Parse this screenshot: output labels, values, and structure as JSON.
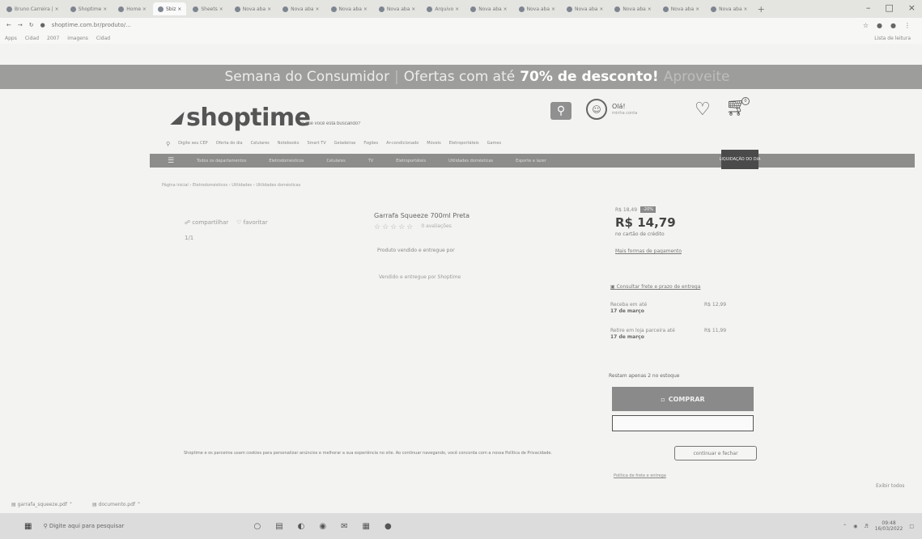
{
  "browser": {
    "tabs": [
      {
        "label": "Bruno Carreira | ×",
        "active": false
      },
      {
        "label": "Shoptime ×",
        "active": false
      },
      {
        "label": "Home ×",
        "active": false
      },
      {
        "label": "Sbiz ×",
        "active": true
      },
      {
        "label": "Sheets ×",
        "active": false
      },
      {
        "label": "Nova aba ×",
        "active": false
      },
      {
        "label": "Nova aba ×",
        "active": false
      },
      {
        "label": "Nova aba ×",
        "active": false
      },
      {
        "label": "Nova aba ×",
        "active": false
      },
      {
        "label": "Arquivo ×",
        "active": false
      },
      {
        "label": "Nova aba ×",
        "active": false
      },
      {
        "label": "Nova aba ×",
        "active": false
      },
      {
        "label": "Nova aba ×",
        "active": false
      },
      {
        "label": "Nova aba ×",
        "active": false
      },
      {
        "label": "Nova aba ×",
        "active": false
      },
      {
        "label": "Nova aba ×",
        "active": false
      }
    ],
    "url": "shoptime.com.br/produto/...",
    "bookmarks": [
      "Apps",
      "Cidad",
      "2007",
      "imagens",
      "Cidad"
    ],
    "reading_list": "Lista de leitura"
  },
  "promo": {
    "lead": "Semana do Consumidor",
    "text": "Ofertas com até",
    "highlight": "70% de desconto!",
    "tail": "Aproveite"
  },
  "header": {
    "logo": "shoptime",
    "search_placeholder": "o que você está buscando?",
    "greeting": "Olá!",
    "greeting_sub": "minha conta",
    "cart_count": "0"
  },
  "cep_bar": {
    "cep_label": "Digite seu CEP",
    "links": [
      "Oferta do dia",
      "Celulares",
      "Notebooks",
      "Smart TV",
      "Geladeiras",
      "Fogões",
      "Ar-condicionado",
      "Móveis",
      "Eletroportáteis",
      "Games"
    ]
  },
  "nav": {
    "items": [
      "Todos os departamentos",
      "Eletrodomésticos",
      "Celulares",
      "TV",
      "Eletroportáteis",
      "Utilidades domésticas",
      "Esporte e lazer"
    ],
    "deal": "LIQUIDAÇÃO DO DIA"
  },
  "breadcrumb": "Página inicial  ›  Eletrodomésticos  ›  Utilidades  ›  Utilidades domésticas",
  "product": {
    "share": "compartilhar",
    "favorite": "favoritar",
    "counter": "1/1",
    "title": "Garrafa Squeeze 700ml Preta",
    "stars": "☆☆☆☆☆",
    "reviews": "0 avaliações",
    "brand": "Produto vendido e entregue por",
    "seller": "Vendido e entregue por Shoptime",
    "old_price": "R$ 18,49",
    "discount": "-20%",
    "price": "R$ 14,79",
    "price_note": "no cartão de crédito",
    "more_ways": "Mais formas de pagamento",
    "cep_link": "Consultar frete e prazo de entrega",
    "ship_a_label": "Receba em até",
    "ship_a_date": "17 de março",
    "ship_a_value": "R$ 12,99",
    "ship_b_label": "Retire em loja parceira até",
    "ship_b_date": "17 de março",
    "ship_b_value": "R$ 11,99",
    "units": "Restam apenas 2 no estoque",
    "buy": "COMPRAR",
    "freight_policy": "Política de frete e entrega"
  },
  "cookie": {
    "text": "Shoptime e os parceiros usam cookies para personalizar anúncios e melhorar a sua experiência no site. Ao continuar navegando, você concorda com a nossa Política de Privacidade.",
    "button": "continuar e fechar"
  },
  "downloads": {
    "files": [
      "garrafa_squeeze.pdf",
      "documento.pdf"
    ],
    "show_all": "Exibir todos"
  },
  "taskbar": {
    "search": "Digite aqui para pesquisar",
    "time": "09:48",
    "date": "16/03/2022"
  }
}
